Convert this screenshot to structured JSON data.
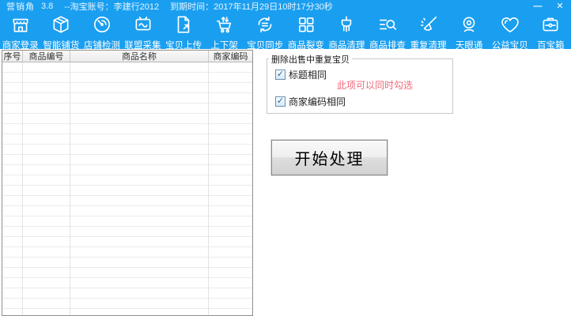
{
  "titlebar": {
    "app_name": "营销角",
    "version": "3.8",
    "account": "--淘宝账号：李建行2012",
    "expiry": "到期时间：2017年11月29日10时17分30秒",
    "minimize_glyph": "—",
    "close_glyph": "✕"
  },
  "toolbar": {
    "items": [
      {
        "label": "商家登录",
        "icon": "storefront-icon"
      },
      {
        "label": "智能铺货",
        "icon": "package-icon"
      },
      {
        "label": "店铺检测",
        "icon": "radar-icon"
      },
      {
        "label": "联盟采集",
        "icon": "monitor-wave-icon"
      },
      {
        "label": "宝贝上传",
        "icon": "document-upload-icon"
      },
      {
        "label": "上下架",
        "icon": "cart-arrows-icon"
      },
      {
        "label": "宝贝同步",
        "icon": "sync-icon"
      },
      {
        "label": "商品裂变",
        "icon": "grid-icon"
      },
      {
        "label": "商品清理",
        "icon": "brush-icon"
      },
      {
        "label": "商品排查",
        "icon": "search-list-icon"
      },
      {
        "label": "重复清理",
        "icon": "sweep-icon"
      },
      {
        "label": "天眼通",
        "icon": "webcam-icon"
      },
      {
        "label": "公益宝贝",
        "icon": "heart-icon"
      },
      {
        "label": "百宝箱",
        "icon": "toolbox-icon"
      }
    ]
  },
  "table": {
    "columns": [
      "序号",
      "商品编号",
      "商品名称",
      "商家编码"
    ]
  },
  "panel": {
    "group_title": "删除出售中重复宝贝",
    "checkbox_title_same": {
      "label": "标题相同",
      "checked": true
    },
    "checkbox_code_same": {
      "label": "商家编码相同",
      "checked": true
    },
    "check_glyph": "✓",
    "note": "此项可以同时勾选",
    "note_color": "#f0697a",
    "start_button_label": "开始处理"
  },
  "colors": {
    "accent_blue": "#1a9ff0",
    "note_red": "#f0697a"
  }
}
